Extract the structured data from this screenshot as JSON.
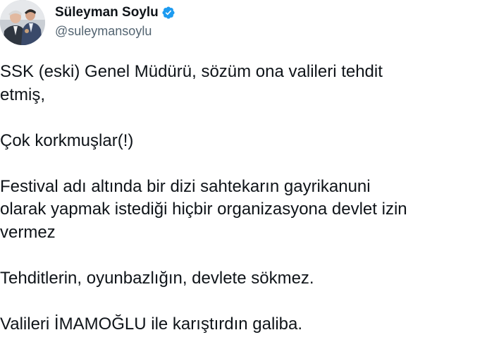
{
  "author": {
    "display_name": "Süleyman Soylu",
    "handle": "@suleymansoylu",
    "verified_icon": "verified-badge-icon",
    "verified_color": "#1d9bf0",
    "avatar": "profile-photo"
  },
  "tweet": {
    "lines": [
      "SSK (eski) Genel Müdürü, sözüm ona valileri tehdit",
      "etmiş,",
      "Çok korkmuşlar(!)",
      "Festival adı altında bir dizi sahtekarın gayrikanuni",
      "olarak yapmak istediği hiçbir organizasyona devlet izin",
      "vermez",
      "Tehditlerin, oyunbazlığın, devlete sökmez.",
      "Valileri İMAMOĞLU ile karıştırdın galiba."
    ]
  },
  "colors": {
    "text": "#0f1419",
    "secondary": "#536471",
    "background": "#ffffff"
  }
}
